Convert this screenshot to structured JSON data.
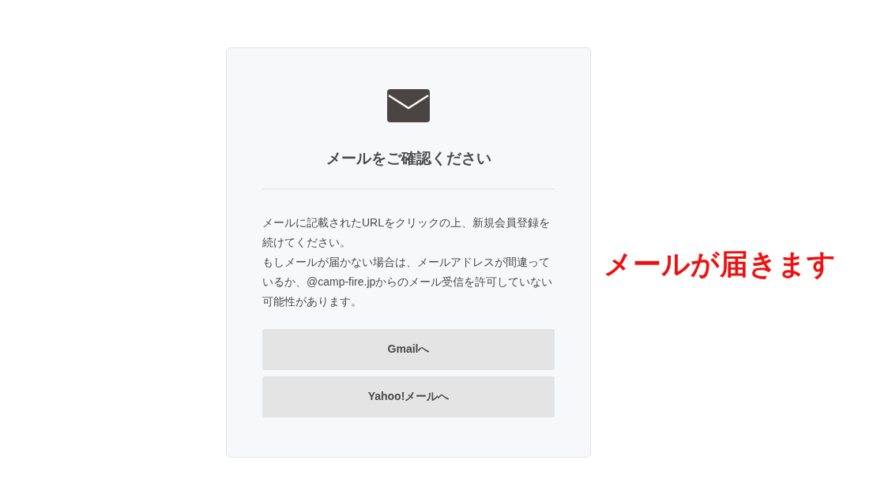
{
  "title": "メールをご確認ください",
  "message": [
    "メールに記載されたURLをクリックの上、新規会員登録を続けてください。",
    "もしメールが届かない場合は、メールアドレスが間違っているか、@camp-fire.jpからのメール受信を許可していない可能性があります。"
  ],
  "buttons": [
    {
      "label": "Gmailへ"
    },
    {
      "label": "Yahoo!メールへ"
    }
  ],
  "annotation": "メールが届きます"
}
